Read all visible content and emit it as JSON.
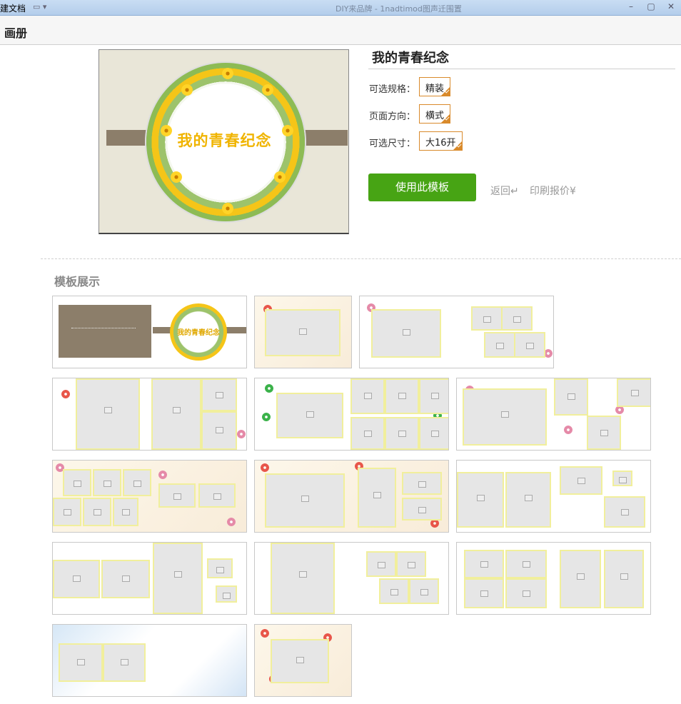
{
  "window": {
    "left_fragment": "建文档",
    "title": "DIY来品牌 - 1nadtimod图声迁围置"
  },
  "header": {
    "title": "画册"
  },
  "cover": {
    "text": "我的青春纪念"
  },
  "product": {
    "title": "我的青春纪念",
    "options": [
      {
        "label": "可选规格：",
        "value": "精装"
      },
      {
        "label": "页面方向：",
        "value": "横式"
      },
      {
        "label": "可选尺寸：",
        "value": "大16开"
      }
    ],
    "use_button": "使用此模板",
    "back_link": "返回↵",
    "price_link": "印刷报价¥"
  },
  "gallery": {
    "title": "模板展示",
    "template_count": 14
  },
  "colors": {
    "accent_green": "#47a414",
    "option_border": "#d98a2b",
    "cover_band": "#8c7e6a",
    "flower_yellow": "#f5c518"
  },
  "icons": [
    "image-placeholder-icon",
    "checkmark-icon",
    "close-icon",
    "minimize-icon",
    "maximize-icon"
  ]
}
